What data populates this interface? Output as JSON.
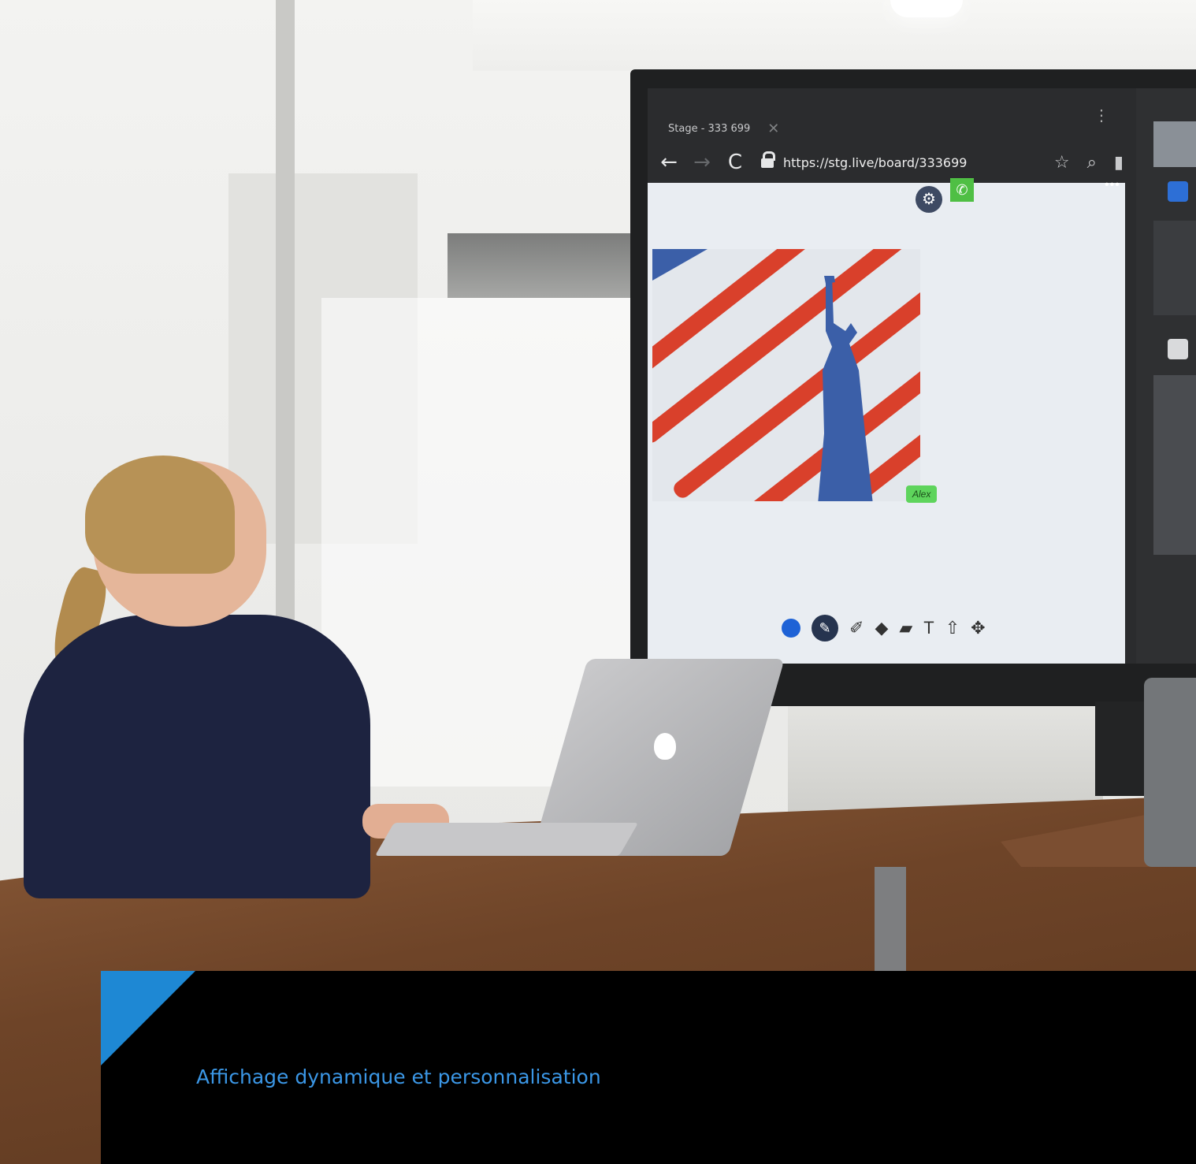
{
  "browser": {
    "tab_title": "Stage - 333 699",
    "tab_close_icon": "close-icon",
    "url": "https://stg.live/board/333699"
  },
  "board": {
    "cursor_label": "Alex",
    "toolbar_text_tool": "T",
    "colors": {
      "active_color": "#1e62d6",
      "call_green": "#4fbf44",
      "stripe_red": "#d9402b",
      "statue_blue": "#3b5fa8"
    }
  },
  "caption": {
    "eyebrow": "Affichage dynamique et personnalisation",
    "headline": "",
    "accent_color": "#1e88d4"
  }
}
